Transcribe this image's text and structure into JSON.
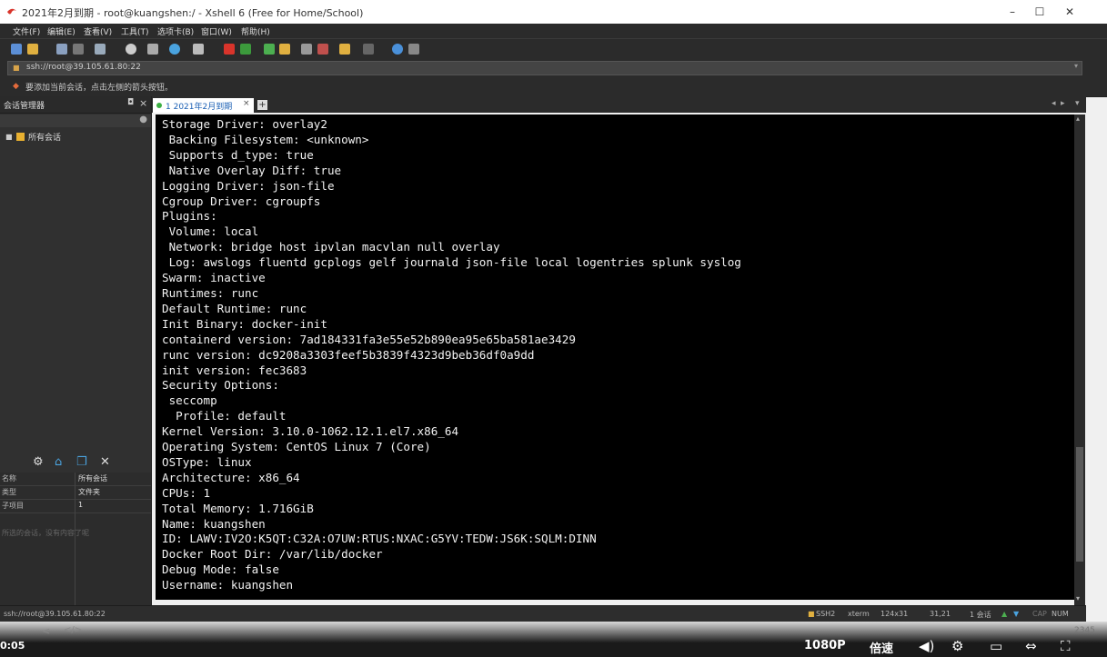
{
  "window": {
    "title": "2021年2月到期 - root@kuangshen:/ - Xshell 6 (Free for Home/School)",
    "controls": {
      "minimize": "–",
      "maximize": "☐",
      "close": "✕"
    }
  },
  "menu": [
    "文件(F)",
    "编辑(E)",
    "查看(V)",
    "工具(T)",
    "选项卡(B)",
    "窗口(W)",
    "帮助(H)"
  ],
  "address": {
    "value": "ssh://root@39.105.61.80:22"
  },
  "hint": {
    "text": "要添加当前会话，点击左侧的箭头按钮。"
  },
  "session_manager": {
    "title": "会话管理器",
    "tree_root": "所有会话",
    "properties": [
      {
        "key": "名称",
        "value": "所有会话"
      },
      {
        "key": "类型",
        "value": "文件夹"
      },
      {
        "key": "子项目",
        "value": "1"
      }
    ],
    "description": "所选的会话，没有内容了呢"
  },
  "tab": {
    "index": "1",
    "label": "2021年2月到期"
  },
  "terminal": {
    "lines": [
      "Storage Driver: overlay2",
      " Backing Filesystem: <unknown>",
      " Supports d_type: true",
      " Native Overlay Diff: true",
      "Logging Driver: json-file",
      "Cgroup Driver: cgroupfs",
      "Plugins:",
      " Volume: local",
      " Network: bridge host ipvlan macvlan null overlay",
      " Log: awslogs fluentd gcplogs gelf journald json-file local logentries splunk syslog",
      "Swarm: inactive",
      "Runtimes: runc",
      "Default Runtime: runc",
      "Init Binary: docker-init",
      "containerd version: 7ad184331fa3e55e52b890ea95e65ba581ae3429",
      "runc version: dc9208a3303feef5b3839f4323d9beb36df0a9dd",
      "init version: fec3683",
      "Security Options:",
      " seccomp",
      "  Profile: default",
      "Kernel Version: 3.10.0-1062.12.1.el7.x86_64",
      "Operating System: CentOS Linux 7 (Core)",
      "OSType: linux",
      "Architecture: x86_64",
      "CPUs: 1",
      "Total Memory: 1.716GiB",
      "Name: kuangshen",
      "ID: LAWV:IV2O:K5QT:C32A:O7UW:RTUS:NXAC:G5YV:TEDW:JS6K:SQLM:DINN",
      "Docker Root Dir: /var/lib/docker",
      "Debug Mode: false",
      "Username: kuangshen"
    ]
  },
  "status": {
    "connection": "ssh://root@39.105.61.80:22",
    "protocol": "SSH2",
    "terminal_type": "xterm",
    "size": "124x31",
    "cursor": "31,21",
    "sessions": "1 会话",
    "cap": "CAP",
    "num": "NUM"
  },
  "video": {
    "time": "0:05",
    "quality": "1080P",
    "speed": "倍速",
    "count": "2345"
  }
}
